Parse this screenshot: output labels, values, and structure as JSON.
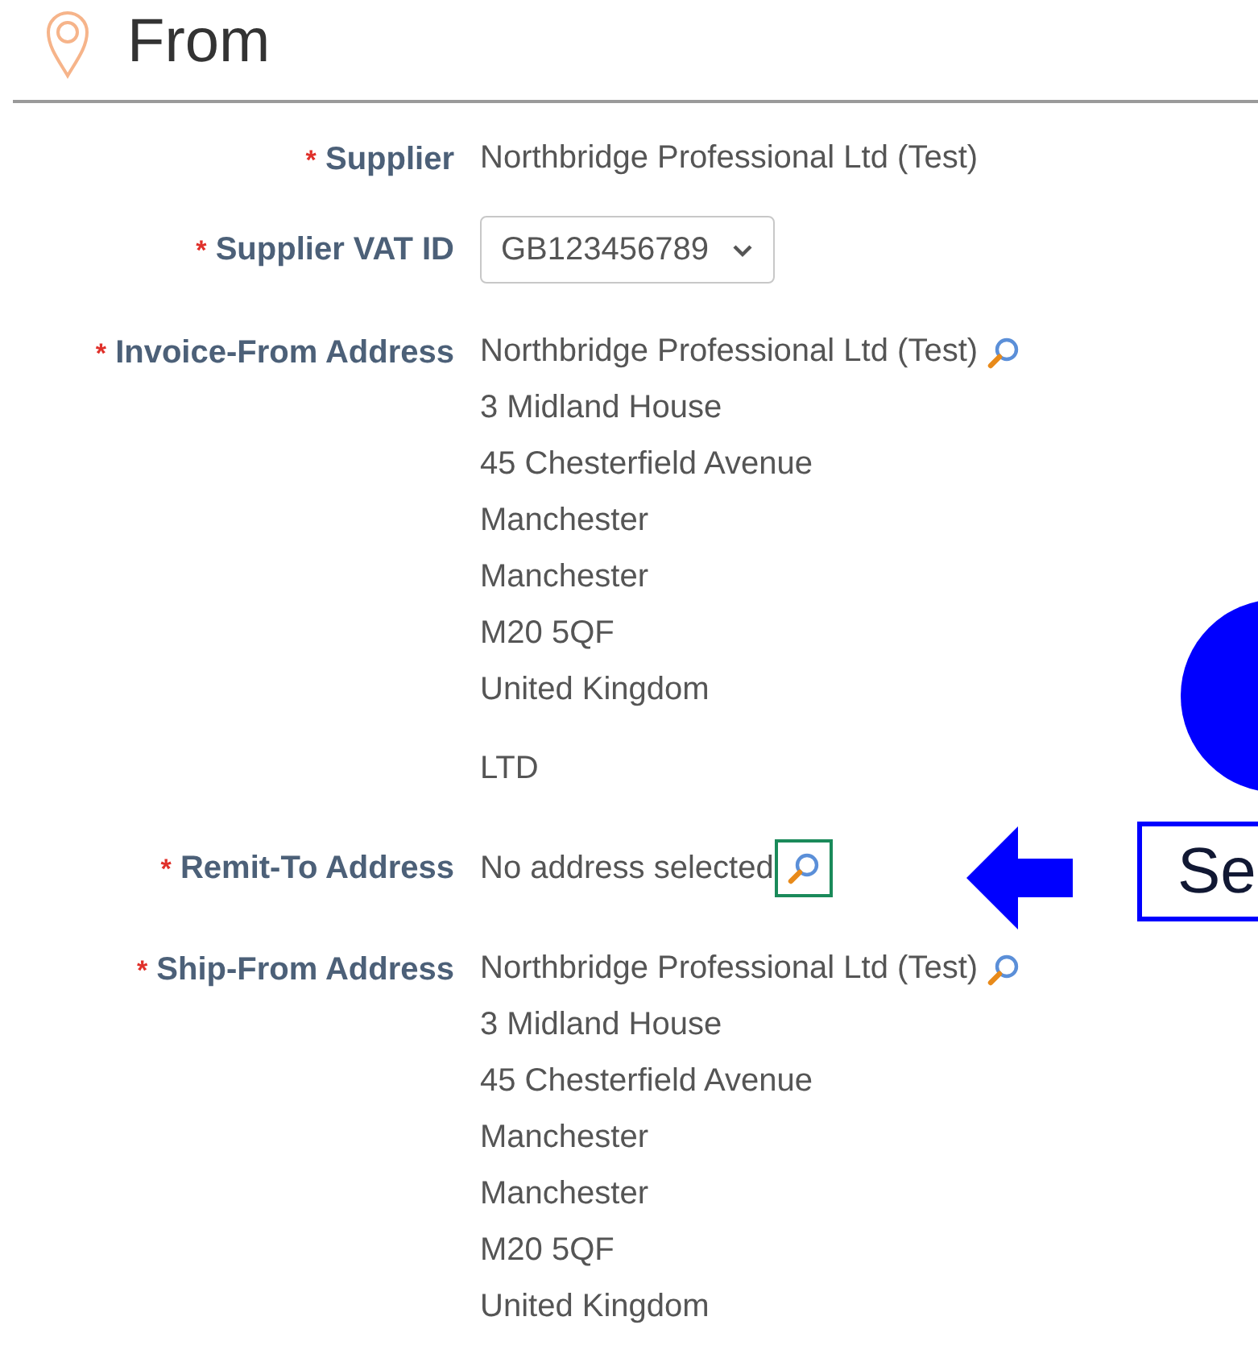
{
  "section": {
    "title": "From"
  },
  "fields": [
    {
      "kind": "text",
      "mark": "*",
      "label": "Supplier",
      "value": "Northbridge Professional Ltd (Test)"
    },
    {
      "kind": "select",
      "mark": "*",
      "label": "Supplier VAT ID",
      "value": "GB123456789"
    },
    {
      "kind": "address",
      "mark": "*",
      "label": "Invoice-From Address",
      "lines": [
        "Northbridge Professional Ltd (Test)",
        "3 Midland House",
        "45 Chesterfield Avenue",
        "Manchester",
        "Manchester",
        "M20 5QF",
        "United Kingdom"
      ],
      "extra": "LTD",
      "highlighted": false
    },
    {
      "kind": "address",
      "mark": "*",
      "label": "Remit-To Address",
      "lines": [
        "No address selected"
      ],
      "highlighted": true
    },
    {
      "kind": "address",
      "mark": "*",
      "label": "Ship-From Address",
      "lines": [
        "Northbridge Professional Ltd (Test)",
        "3 Midland House",
        "45 Chesterfield Avenue",
        "Manchester",
        "Manchester",
        "M20 5QF",
        "United Kingdom"
      ],
      "highlighted": false
    }
  ],
  "annotation": {
    "callout": "Se"
  }
}
